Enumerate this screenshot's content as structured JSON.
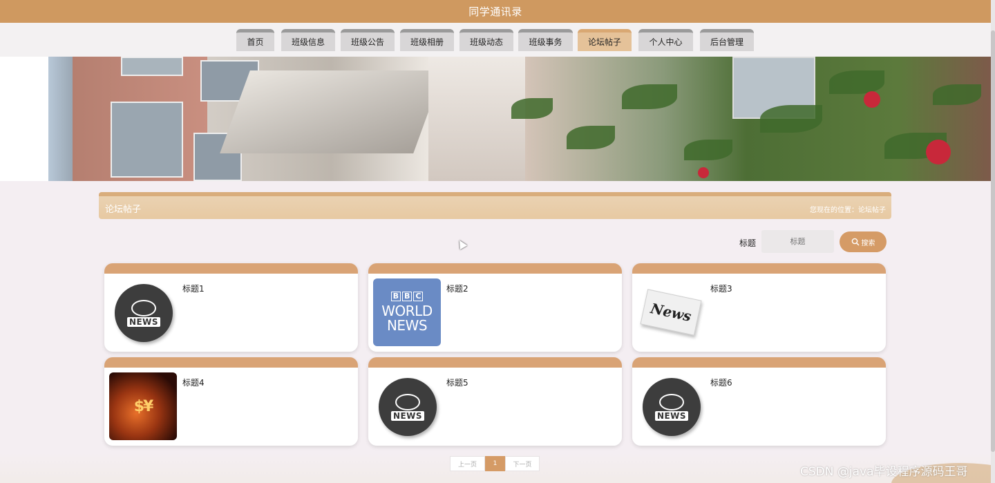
{
  "header": {
    "title": "同学通讯录"
  },
  "nav": {
    "items": [
      {
        "label": "首页"
      },
      {
        "label": "班级信息"
      },
      {
        "label": "班级公告"
      },
      {
        "label": "班级相册"
      },
      {
        "label": "班级动态"
      },
      {
        "label": "班级事务"
      },
      {
        "label": "论坛帖子",
        "active": true
      },
      {
        "label": "个人中心"
      },
      {
        "label": "后台管理"
      }
    ]
  },
  "section": {
    "title": "论坛帖子",
    "breadcrumb": "您现在的位置：论坛帖子"
  },
  "search": {
    "label": "标题",
    "placeholder": "标题",
    "button_label": "搜索"
  },
  "posts": [
    {
      "title": "标题1",
      "thumb": "news-globe-icon"
    },
    {
      "title": "标题2",
      "thumb": "bbc-world-news-logo",
      "logo_text": [
        "B",
        "B",
        "C",
        "WORLD",
        "NEWS"
      ]
    },
    {
      "title": "标题3",
      "thumb": "newspaper-image",
      "logo_text": "News"
    },
    {
      "title": "标题4",
      "thumb": "currency-symbols-image",
      "logo_text": "$¥"
    },
    {
      "title": "标题5",
      "thumb": "news-globe-icon"
    },
    {
      "title": "标题6",
      "thumb": "news-globe-icon"
    }
  ],
  "globe_text": "NEWS",
  "pagination": {
    "prev": "上一页",
    "current": "1",
    "next": "下一页"
  },
  "watermark": "CSDN @java毕设程序源码王哥",
  "colors": {
    "primary": "#cf9960",
    "accent": "#d59b66",
    "active_tab": "#e5c299"
  }
}
